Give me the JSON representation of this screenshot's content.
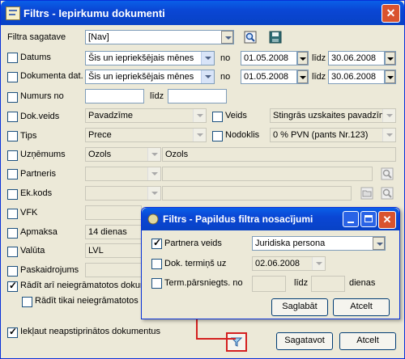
{
  "window": {
    "title": "Filtrs - Iepirkumu dokumenti"
  },
  "form": {
    "template_label": "Filtra sagatave",
    "template_value": "[Nav]",
    "date_label": "Datums",
    "date_period": "Šis un iepriekšējais mēnes",
    "date_from": "01.05.2008",
    "date_to": "30.06.2008",
    "docdate_label": "Dokumenta dat.",
    "docdate_period": "Šis un iepriekšējais mēnes",
    "docdate_from": "01.05.2008",
    "docdate_to": "30.06.2008",
    "number_label": "Numurs no",
    "doctype_label": "Dok.veids",
    "doctype_value": "Pavadzīme",
    "kind_label": "Veids",
    "kind_value": "Stingrās uzskaites pavadzīme",
    "type_label": "Tips",
    "type_value": "Prece",
    "tax_label": "Nodoklis",
    "tax_value": "0 % PVN (pants Nr.123)",
    "company_label": "Uzņēmums",
    "company_code": "Ozols",
    "company_name": "Ozols",
    "partner_label": "Partneris",
    "ekcode_label": "Ek.kods",
    "vfk_label": "VFK",
    "payment_label": "Apmaksa",
    "payment_value": "14 dienas",
    "currency_label": "Valūta",
    "currency_value": "LVL",
    "explanations_label": "Paskaidrojums",
    "show_unregistered_label": "Rādīt arī neiegrāmatotos dokumentus",
    "show_only_unregistered_label": "Rādīt tikai neiegrāmatotos dokumentus",
    "include_unconfirmed_label": "Iekļaut neapstiprinātos dokumentus",
    "from": "no",
    "to": "līdz"
  },
  "buttons": {
    "save": "Sagatavot",
    "cancel": "Atcelt"
  },
  "subdialog": {
    "title": "Filtrs - Papildus filtra nosacījumi",
    "partner_type_label": "Partnera veids",
    "partner_type_value": "Juridiska persona",
    "due_label": "Dok. termiņš uz",
    "due_value": "02.06.2008",
    "overdue_label": "Term.pārsniegts. no",
    "to": "līdz",
    "days": "dienas",
    "save": "Saglabāt",
    "cancel": "Atcelt"
  },
  "colors": {
    "title_bar": "#0a46d4",
    "highlight": "#d42020"
  }
}
